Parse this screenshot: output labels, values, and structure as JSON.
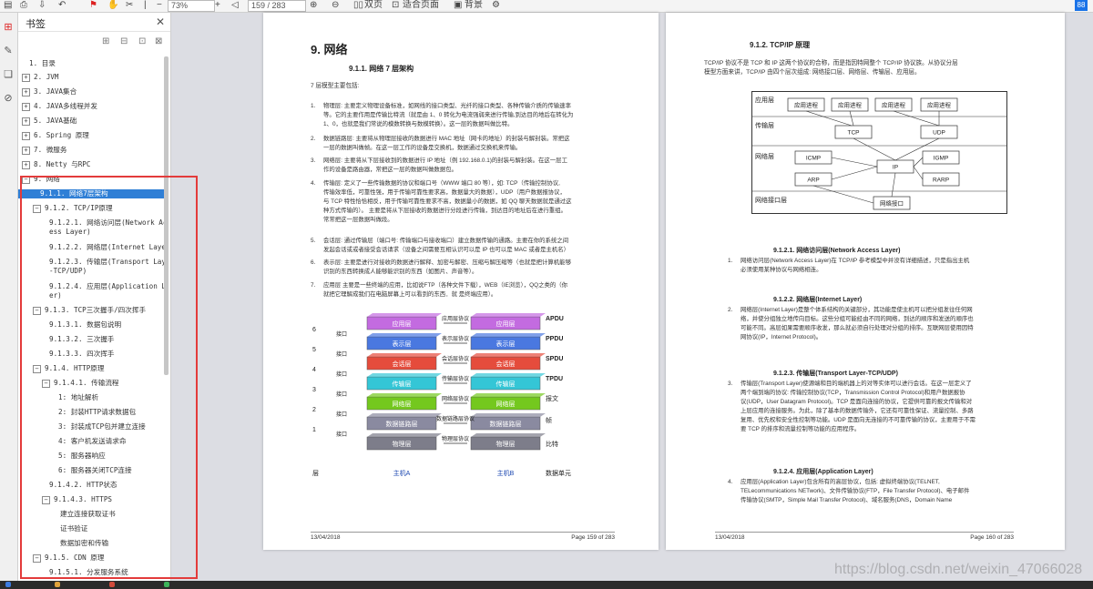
{
  "toolbar": {
    "zoom": "73%",
    "page_input": "159 / 283",
    "double_page": "双页",
    "fit_page": "适合页面",
    "background": "背景",
    "brand_label": "88"
  },
  "bookmark_panel": {
    "title": "书签",
    "items": [
      {
        "label": "1. 目录"
      },
      {
        "label": "2. JVM"
      },
      {
        "label": "3. JAVA集合"
      },
      {
        "label": "4. JAVA多线程并发"
      },
      {
        "label": "5. JAVA基础"
      },
      {
        "label": "6. Spring 原理"
      },
      {
        "label": "7.  微服务"
      },
      {
        "label": "8. Netty 与RPC"
      },
      {
        "label": "9. 网络"
      },
      {
        "label": "9.1.1. 网络7层架构"
      },
      {
        "label": "9.1.2. TCP/IP原理"
      },
      {
        "label": "9.1.2.1. 网络访问层(Network Acc"
      },
      {
        "label": "ess Layer)"
      },
      {
        "label": "9.1.2.2. 网络层(Internet Layer)"
      },
      {
        "label": "9.1.2.3. 传输层(Transport Layer"
      },
      {
        "label": "-TCP/UDP)"
      },
      {
        "label": "9.1.2.4. 应用层(Application Lay"
      },
      {
        "label": "er)"
      },
      {
        "label": "9.1.3. TCP三次握手/四次挥手"
      },
      {
        "label": "9.1.3.1. 数据包说明"
      },
      {
        "label": "9.1.3.2. 三次握手"
      },
      {
        "label": "9.1.3.3. 四次挥手"
      },
      {
        "label": "9.1.4. HTTP原理"
      },
      {
        "label": "9.1.4.1. 传输流程"
      },
      {
        "label": "1: 地址解析"
      },
      {
        "label": "2: 封装HTTP请求数据包"
      },
      {
        "label": "3: 封装成TCP包并建立连接"
      },
      {
        "label": "4: 客户机发送请求命"
      },
      {
        "label": "5: 服务器响应"
      },
      {
        "label": "6: 服务器关闭TCP连接"
      },
      {
        "label": "9.1.4.2. HTTP状态"
      },
      {
        "label": "9.1.4.3. HTTPS"
      },
      {
        "label": "建立连接获取证书"
      },
      {
        "label": "证书验证"
      },
      {
        "label": "数据加密和传输"
      },
      {
        "label": "9.1.5. CDN 原理"
      },
      {
        "label": "9.1.5.1. 分发服务系统"
      }
    ]
  },
  "page_left": {
    "h1": "9. 网络",
    "h2": "9.1.1.  网络 7 层架构",
    "intro": "7 层模型主要包括:",
    "items": [
      {
        "num": "1.",
        "lines": [
          "物理层: 主要定义物理设备标准，如网线的接口类型、光纤的接口类型、各种传输介质的传输速率",
          "等。它的主要作用是传输比特流（就是由 1、0 转化为电流强弱来进行传输,到达目的地后在转化为",
          "1、0，也就是我们常说的模数转换与数模转换）。这一层的数据叫做比特。"
        ]
      },
      {
        "num": "2.",
        "lines": [
          "数据链路层: 主要将从物理层接收的数据进行 MAC 地址（网卡的地址）的封装与解封装。常把这",
          "一层的数据叫做帧。在这一层工作的设备是交换机，数据通过交换机来传输。"
        ]
      },
      {
        "num": "3.",
        "lines": [
          "网络层: 主要将从下层接收到的数据进行 IP 地址（例 192.168.0.1)的封装与解封装。在这一层工",
          "作的设备是路由器，常把这一层的数据叫做数据包。"
        ]
      },
      {
        "num": "4.",
        "lines": [
          "传输层: 定义了一些传输数据的协议和端口号（WWW 端口 80 等），如: TCP（传输控制协议,",
          "传输效率低，可靠性强，用于传输可靠性要求高，数据量大的数据），UDP（用户数据报协议，",
          "与 TCP 特性恰恰相反，用于传输可靠性要求不高，数据量小的数据，如 QQ 聊天数据就是通过这",
          "种方式传输的）。 主要是将从下层接收的数据进行分段进行传输，到达目的地址后在进行重组。",
          "常常把这一层数据叫做段。"
        ]
      },
      {
        "num": "5.",
        "lines": [
          "会话层: 通过传输层（端口号: 传输端口与接收端口）建立数据传输的通路。主要在你的系统之间",
          "发起会话或或者接受会话请求（设备之间需要互相认识可以是 IP 也可以是 MAC 或者是主机名）"
        ]
      },
      {
        "num": "6.",
        "lines": [
          "表示层: 主要是进行对接收的数据进行解释、加密与解密、压缩与解压缩等（也就是把计算机能够",
          "识别的东西转换成人能够能识别的东西（如图片、声音等）。"
        ]
      },
      {
        "num": "7.",
        "lines": [
          "应用层 主要是一些终端的应用，比如说FTP（各种文件下载），WEB（IE浏览），QQ之类的（你",
          "就把它理解成我们在电脑屏幕上可以看到的东西．就 是终端应用）。"
        ]
      }
    ],
    "osi": {
      "right_labels": [
        "APDU",
        "PPDU",
        "SPDU",
        "TPDU",
        "报文",
        "帧",
        "比特",
        "数据单元"
      ],
      "layer_numbers": [
        "6",
        "5",
        "4",
        "3",
        "2",
        "1",
        "层"
      ],
      "left_labels": [
        "接口",
        "接口",
        "接口",
        "接口",
        "接口",
        "接口"
      ],
      "blocks": [
        "应用层",
        "表示层",
        "会话层",
        "传输层",
        "网络层",
        "数据链路层",
        "物理层"
      ],
      "protocols": [
        "应用层协议",
        "表示层协议",
        "会话层协议",
        "传输层协议",
        "网络层协议",
        "数据链路层协议",
        "物理层协议"
      ],
      "host_a": "主机A",
      "host_b": "主机B",
      "colors": [
        "#c36be0",
        "#4a78e0",
        "#e54c3c",
        "#34c6d6",
        "#74c81e",
        "#8a8aa0",
        "#7d7d8a"
      ]
    },
    "footer_left": "13/04/2018",
    "footer_right": "Page 159 of 283"
  },
  "page_right": {
    "h2_top": "9.1.2.  TCP/IP 原理",
    "intro": [
      "TCP/IP 协议不是 TCP 和 IP 这两个协议的合称，而是指因特网整个 TCP/IP 协议族。从协议分层",
      "模型方面来讲，TCP/IP 由四个层次组成: 网络接口层、网络层、传输层、应用层。"
    ],
    "diagram": {
      "layers": [
        "应用层",
        "传输层",
        "网络层",
        "网络接口层"
      ],
      "app_processes": [
        "应用进程",
        "应用进程",
        "应用进程",
        "应用进程"
      ],
      "tcp": "TCP",
      "udp": "UDP",
      "icmp": "ICMP",
      "igmp": "IGMP",
      "ip": "IP",
      "arp": "ARP",
      "rarp": "RARP",
      "netif": "网络接口"
    },
    "sections": [
      {
        "heading": "9.1.2.1.     网络访问层(Network Access Layer)",
        "num": "1.",
        "lines": [
          "网络访问层(Network Access Layer)在 TCP/IP 参考模型中并没有详细描述，只是指出主机",
          "必须使用某种协议与网络相连。"
        ]
      },
      {
        "heading": "9.1.2.2.     网络层(Internet Layer)",
        "num": "2.",
        "lines": [
          "网络层(Internet Layer)是整个体系结构的关键部分，其功能是使主机可以把分组发往任何网",
          "络，并使分组独立地传向目标。这些分组可能经由不同的网络，到达的顺序和发送的顺序也",
          "可能不同。高层如果需要顺序收发，那么就必须自行处理对分组的排序。互联网层使用因特",
          "网协议(IP，Internet Protocol)。"
        ]
      },
      {
        "heading": "9.1.2.3.     传输层(Transport Layer-TCP/UDP)",
        "num": "3.",
        "lines": [
          "传输层(Transport Layer)使源端和目的端机器上的对等实体可以进行会话。在这一层定义了",
          "两个端到端的协议: 传输控制协议(TCP，Transmission Control Protocol)和用户数据报协",
          "议(UDP，User Datagram Protocol)。TCP 是面向连接的协议，它提供可靠的报文传输和对",
          "上层应用的连接服务。为此，除了基本的数据传输外，它还有可靠性保证、流量控制、多路",
          "复用、优先权和安全性控制等功能。UDP 是面向无连接的不可靠传输的协议，主要用于不需",
          "要 TCP 的排序和流量控制等功能的应用程序。"
        ]
      },
      {
        "heading": "9.1.2.4.     应用层(Application Layer)",
        "num": "4.",
        "lines": [
          "应用层(Application Layer)包含所有的高层协议，包括: 虚拟终端协议(TELNET,",
          "TELecommunications NETwork)、文件传输协议(FTP，File Transfer Protocol)、电子邮件",
          "传输协议(SMTP，Simple Mail Transfer Protocol)、域名服务(DNS，Domain Name"
        ]
      }
    ],
    "footer_left": "13/04/2018",
    "footer_right": "Page 160 of 283"
  },
  "watermark": "https://blog.csdn.net/weixin_47066028"
}
